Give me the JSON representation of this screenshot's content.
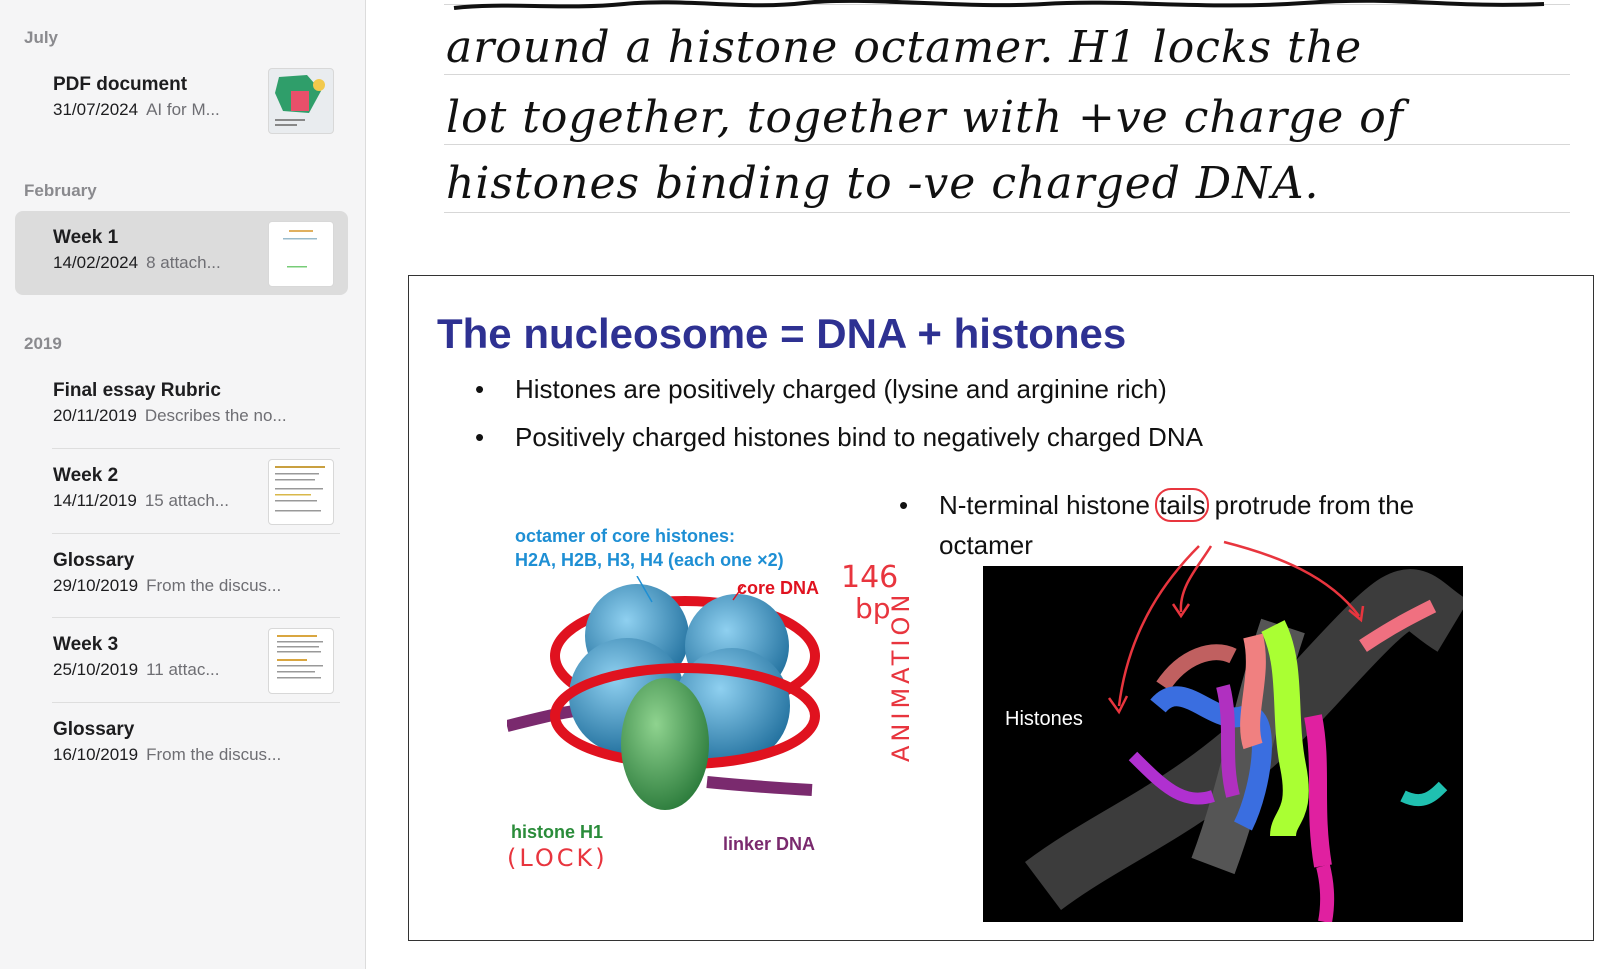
{
  "sidebar": {
    "sections": [
      {
        "label": "July"
      },
      {
        "label": "February"
      },
      {
        "label": "2019"
      }
    ],
    "notes": [
      {
        "title": "PDF document",
        "date": "31/07/2024",
        "preview": "AI for M..."
      },
      {
        "title": "Week 1",
        "date": "14/02/2024",
        "preview": "8 attach..."
      },
      {
        "title": "Final essay Rubric",
        "date": "20/11/2019",
        "preview": "Describes the no..."
      },
      {
        "title": "Week 2",
        "date": "14/11/2019",
        "preview": "15 attach..."
      },
      {
        "title": "Glossary",
        "date": "29/10/2019",
        "preview": "From the discus..."
      },
      {
        "title": "Week 3",
        "date": "25/10/2019",
        "preview": "11 attac..."
      },
      {
        "title": "Glossary",
        "date": "16/10/2019",
        "preview": "From the discus..."
      }
    ]
  },
  "handwriting": {
    "lines": [
      "around a histone octamer. H1 locks the",
      "lot together, together with +ve charge of",
      "histones binding to -ve charged DNA."
    ]
  },
  "slide": {
    "title": "The nucleosome = DNA + histones",
    "bullets": [
      "Histones are positively charged (lysine and arginine rich)",
      "Positively charged histones bind to negatively charged DNA"
    ],
    "bullet3_part1": "N-terminal histone ",
    "bullet3_circled": "tails",
    "bullet3_part2": " protrude from the",
    "bullet3_line2": "octamer",
    "diagram": {
      "octamer_label_1": "octamer of core histones:",
      "octamer_label_2": "H2A, H2B, H3, H4 (each one ×2)",
      "core_dna": "core DNA",
      "histone_h1": "histone H1",
      "linker_dna": "linker DNA"
    },
    "animation_caption": "Histones",
    "annotations": {
      "bp_146": "146",
      "bp_unit": "bp",
      "clock": "(LOCK)",
      "animation": "ANIMATION"
    }
  },
  "colors": {
    "slide_title": "#2e3192",
    "annotation_ink": "#e8353e",
    "selected_note_bg": "#dcdcdc"
  }
}
